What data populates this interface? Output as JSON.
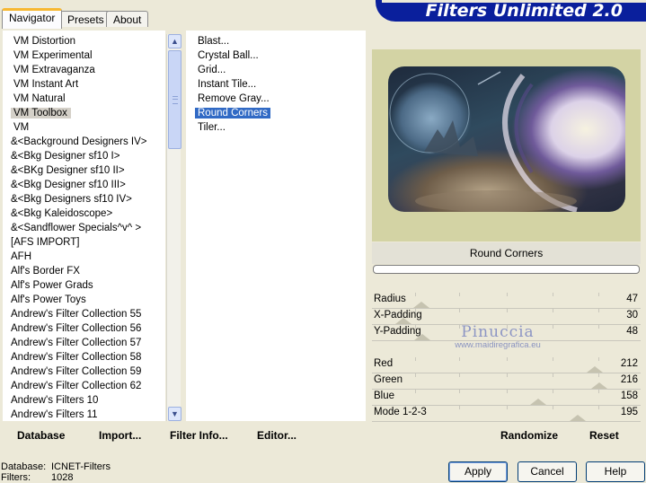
{
  "tabs": [
    {
      "label": "Navigator",
      "active": true
    },
    {
      "label": "Presets",
      "active": false
    },
    {
      "label": "About",
      "active": false
    }
  ],
  "banner": {
    "title": "Filters Unlimited 2.0",
    "color": "#0a1f9c"
  },
  "categories": [
    {
      "label": "VM Distortion"
    },
    {
      "label": "VM Experimental"
    },
    {
      "label": "VM Extravaganza"
    },
    {
      "label": "VM Instant Art"
    },
    {
      "label": "VM Natural"
    },
    {
      "label": "VM Toolbox",
      "selected": true
    },
    {
      "label": "VM"
    },
    {
      "label": "&<Background Designers IV>"
    },
    {
      "label": "&<Bkg Designer sf10 I>"
    },
    {
      "label": "&<BKg Designer sf10 II>"
    },
    {
      "label": "&<Bkg Designer sf10 III>"
    },
    {
      "label": "&<Bkg Designers sf10 IV>"
    },
    {
      "label": "&<Bkg Kaleidoscope>"
    },
    {
      "label": "&<Sandflower Specials^v^ >"
    },
    {
      "label": "[AFS IMPORT]"
    },
    {
      "label": "AFH"
    },
    {
      "label": "Alf's Border FX"
    },
    {
      "label": "Alf's Power Grads"
    },
    {
      "label": "Alf's Power Toys"
    },
    {
      "label": "Andrew's Filter Collection 55"
    },
    {
      "label": "Andrew's Filter Collection 56"
    },
    {
      "label": "Andrew's Filter Collection 57"
    },
    {
      "label": "Andrew's Filter Collection 58"
    },
    {
      "label": "Andrew's Filter Collection 59"
    },
    {
      "label": "Andrew's Filter Collection 62"
    },
    {
      "label": "Andrew's Filters 10"
    },
    {
      "label": "Andrew's Filters 11"
    }
  ],
  "filters": [
    {
      "label": "Blast..."
    },
    {
      "label": "Crystal Ball..."
    },
    {
      "label": "Grid..."
    },
    {
      "label": "Instant Tile..."
    },
    {
      "label": "Remove Gray..."
    },
    {
      "label": "Round Corners",
      "selected": true
    },
    {
      "label": "Tiler..."
    }
  ],
  "preview": {
    "caption": "Round Corners"
  },
  "parameters": [
    {
      "label": "Radius",
      "value": "47",
      "fraction": 0.184
    },
    {
      "label": "X-Padding",
      "value": "30",
      "fraction": 0.118
    },
    {
      "label": "Y-Padding",
      "value": "48",
      "fraction": 0.188
    },
    {
      "label": "Red",
      "value": "212",
      "fraction": 0.831
    },
    {
      "label": "Green",
      "value": "216",
      "fraction": 0.847
    },
    {
      "label": "Blue",
      "value": "158",
      "fraction": 0.62
    },
    {
      "label": "Mode 1-2-3",
      "value": "195",
      "fraction": 0.765
    }
  ],
  "watermark": {
    "name": "Pinuccia",
    "url": "www.maidiregrafica.eu"
  },
  "links": {
    "database": "Database",
    "import": "Import...",
    "filter_info": "Filter Info...",
    "editor": "Editor...",
    "randomize": "Randomize",
    "reset": "Reset"
  },
  "status": {
    "database_label": "Database:",
    "database_value": "ICNET-Filters",
    "filters_label": "Filters:",
    "filters_value": "1028"
  },
  "buttons": {
    "apply": "Apply",
    "cancel": "Cancel",
    "help": "Help"
  }
}
